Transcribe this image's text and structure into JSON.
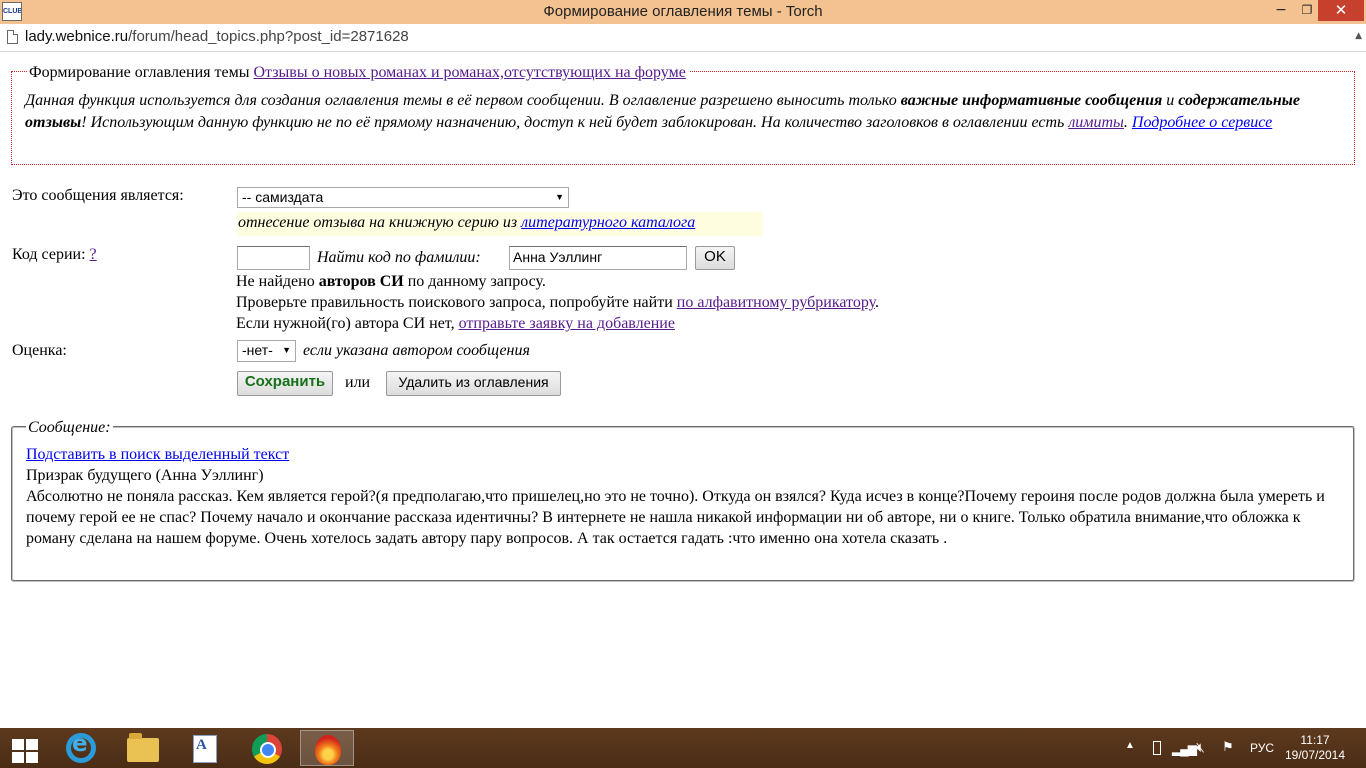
{
  "window": {
    "title": "Формирование оглавления темы - Torch",
    "app_icon_text": "CLUB",
    "controls": {
      "minimize": "−",
      "maximize": "❐",
      "close": "✕"
    }
  },
  "address": {
    "host": "lady.webnice.ru",
    "path": "/forum/head_topics.php?post_id=2871628"
  },
  "info": {
    "legend_prefix": "Формирование оглавления темы",
    "legend_link": "Отзывы о новых романах и романах,отсутствующих на форуме",
    "text_1": "Данная функция используется для создания оглавления темы в её первом сообщении. В оглавление разрешено выносить только ",
    "bold_1": "важные информативные сообщения",
    "text_2": " и ",
    "bold_2": "содержательные отзывы",
    "text_3": "! Использующим данную функцию не по её прямому назначению, доступ к ней будет заблокирован. На количество заголовков в оглавлении есть ",
    "limits_link": "лимиты",
    "text_4": ". ",
    "more_link": "Подробнее о сервисе"
  },
  "form": {
    "type_label": "Это сообщения является:",
    "type_value": "-- самиздата",
    "hint_text": "отнесение отзыва на книжную серию из ",
    "hint_link": "литературного каталога",
    "series_label": "Код серии:",
    "series_help": "?",
    "series_code_value": "",
    "find_label": "Найти код по фамилии:",
    "find_value": "Анна Уэллинг",
    "ok_label": "OK",
    "not_found_prefix": "Не найдено ",
    "not_found_bold": "авторов СИ",
    "not_found_suffix": " по данному запросу.",
    "check_text": "Проверьте правильность поискового запроса, попробуйте найти ",
    "check_link": "по алфавитному рубрикатору",
    "check_end": ".",
    "request_text": "Если нужной(го) автора СИ нет, ",
    "request_link": "отправьте заявку на добавление",
    "rating_label": "Оценка:",
    "rating_value": "-нет-",
    "rating_hint": "если указана автором сообщения",
    "save_label": "Сохранить",
    "or_text": "или",
    "delete_label": "Удалить из оглавления"
  },
  "message": {
    "legend": "Сообщение:",
    "insert_link": "Подставить в поиск выделенный текст",
    "title": "Призрак будущего (Анна Уэллинг)",
    "body": "Абсолютно не поняла рассказ. Кем является герой?(я предполагаю,что пришелец,но это не точно). Откуда он взялся? Куда исчез в конце?Почему героиня после родов должна была умереть и почему герой ее не спас? Почему начало и окончание рассказа идентичны? В интернете не нашла никакой информации ни об авторе, ни о книге. Только обратила внимание,что обложка к роману сделана на нашем форуме. Очень хотелось задать автору пару вопросов. А так остается гадать :что именно она хотела сказать ."
  },
  "taskbar": {
    "apps": [
      "start-icon",
      "ie-icon",
      "explorer-icon",
      "reader-icon",
      "chrome-icon",
      "torch-icon"
    ],
    "language": "РУС",
    "time": "11:17",
    "date": "19/07/2014"
  }
}
